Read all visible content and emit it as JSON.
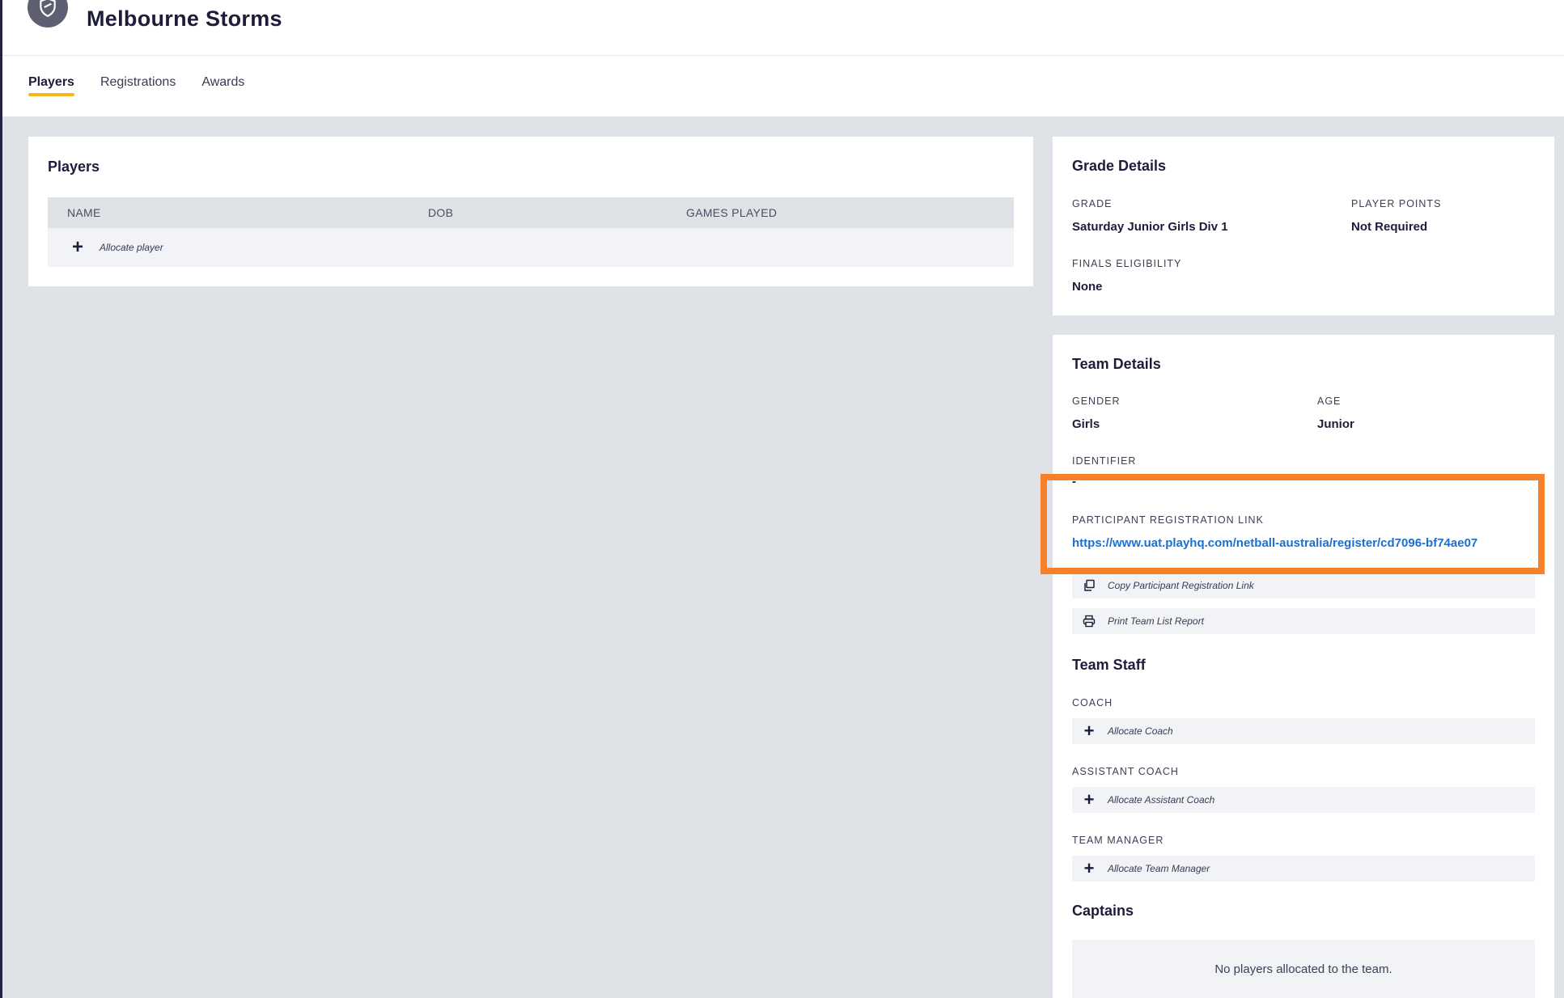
{
  "header": {
    "team_name": "Melbourne Storms",
    "logo_icon": "shield-icon"
  },
  "tabs": [
    {
      "label": "Players",
      "active": true
    },
    {
      "label": "Registrations",
      "active": false
    },
    {
      "label": "Awards",
      "active": false
    }
  ],
  "players_card": {
    "title": "Players",
    "columns": [
      "NAME",
      "DOB",
      "GAMES PLAYED"
    ],
    "allocate_label": "Allocate player"
  },
  "grade_details": {
    "title": "Grade Details",
    "grade_label": "GRADE",
    "grade_value": "Saturday Junior Girls Div 1",
    "player_points_label": "PLAYER POINTS",
    "player_points_value": "Not Required",
    "finals_label": "FINALS ELIGIBILITY",
    "finals_value": "None"
  },
  "team_details": {
    "title": "Team Details",
    "gender_label": "GENDER",
    "gender_value": "Girls",
    "age_label": "AGE",
    "age_value": "Junior",
    "identifier_label": "IDENTIFIER",
    "identifier_value": "-",
    "reg_link_label": "PARTICIPANT REGISTRATION LINK",
    "reg_link_value": "https://www.uat.playhq.com/netball-australia/register/cd7096-bf74ae07",
    "copy_label": "Copy Participant Registration Link",
    "print_label": "Print Team List Report"
  },
  "team_staff": {
    "title": "Team Staff",
    "coach_label": "COACH",
    "coach_action": "Allocate Coach",
    "assistant_label": "ASSISTANT COACH",
    "assistant_action": "Allocate Assistant Coach",
    "manager_label": "TEAM MANAGER",
    "manager_action": "Allocate Team Manager"
  },
  "captains": {
    "title": "Captains",
    "empty_text": "No players allocated to the team."
  },
  "colors": {
    "accent_tab": "#f5b51b",
    "highlight": "#f7812b",
    "link": "#1a6fd4"
  }
}
